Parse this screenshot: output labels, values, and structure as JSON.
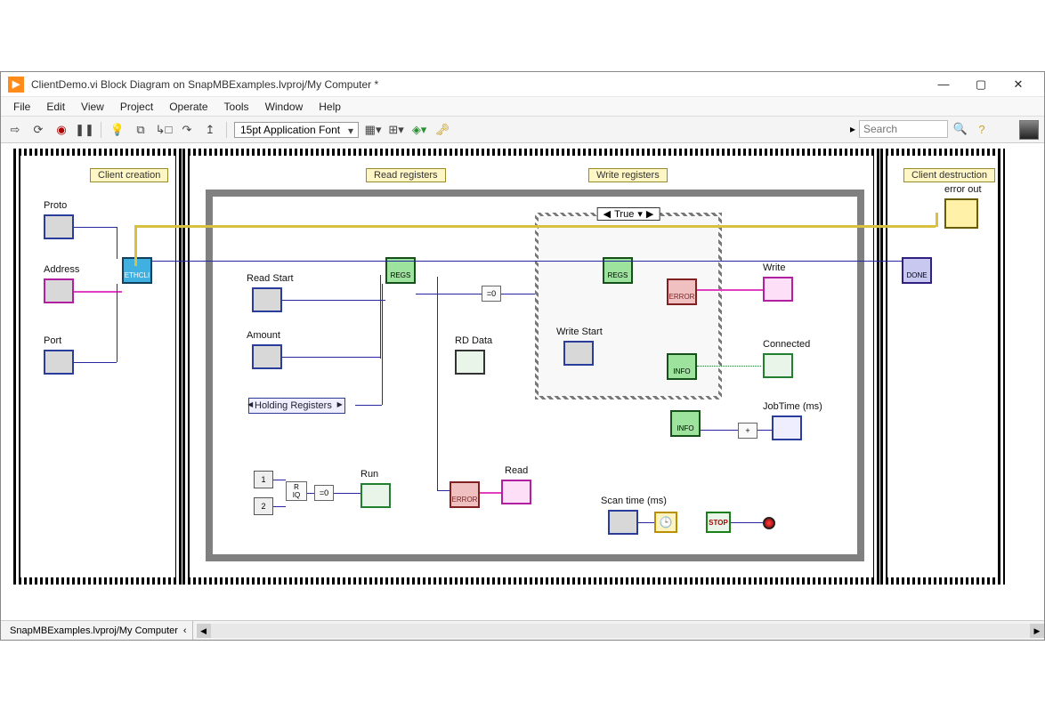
{
  "window": {
    "title": "ClientDemo.vi Block Diagram on SnapMBExamples.lvproj/My Computer *"
  },
  "menu": [
    "File",
    "Edit",
    "View",
    "Project",
    "Operate",
    "Tools",
    "Window",
    "Help"
  ],
  "toolbar": {
    "font": "15pt Application Font",
    "search_placeholder": "Search"
  },
  "statusbar": {
    "project": "SnapMBExamples.lvproj/My Computer"
  },
  "frames": {
    "client_creation": "Client creation",
    "read_registers": "Read registers",
    "write_registers": "Write registers",
    "client_destruction": "Client destruction"
  },
  "case": {
    "selector": "True"
  },
  "labels": {
    "proto": "Proto",
    "address": "Address",
    "port": "Port",
    "read_start": "Read Start",
    "amount": "Amount",
    "holding_regs": "Holding Registers",
    "rd_data": "RD Data",
    "write_start": "Write Start",
    "read": "Read",
    "run": "Run",
    "write": "Write",
    "connected": "Connected",
    "jobtime": "JobTime (ms)",
    "scan_time": "Scan time (ms)",
    "error_out": "error out"
  },
  "subvi": {
    "ethcli": "ETHCLI",
    "regs": "REGS",
    "error": "ERROR",
    "info": "INFO",
    "done": "DONE"
  },
  "stop": "STOP",
  "constants": {
    "one": "1",
    "two": "2",
    "eq0": "=0",
    "plus": "+"
  }
}
